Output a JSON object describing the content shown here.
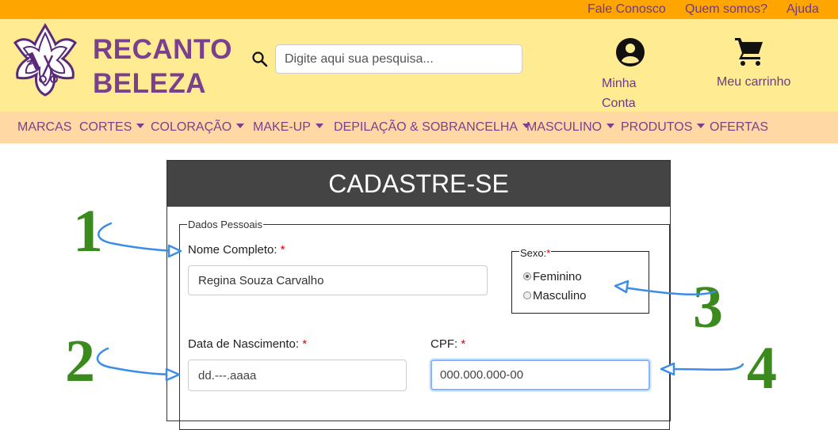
{
  "top_links": [
    "Fale Conosco",
    "Quem somos?",
    "Ajuda"
  ],
  "brand": {
    "line1": "RECANTO",
    "line2": "BELEZA"
  },
  "search": {
    "placeholder": "Digite aqui sua pesquisa..."
  },
  "account": {
    "label": "Minha Conta"
  },
  "cart": {
    "label": "Meu carrinho"
  },
  "nav": [
    {
      "label": "MARCAS"
    },
    {
      "label": "CORTES"
    },
    {
      "label": "COLORAÇÃO"
    },
    {
      "label": "MAKE-UP"
    },
    {
      "label": "DEPILAÇÃO & SOBRANCELHA"
    },
    {
      "label": "MASCULINO"
    },
    {
      "label": "PRODUTOS"
    },
    {
      "label": "OFERTAS"
    }
  ],
  "form": {
    "title": "CADASTRE-SE",
    "legend": "Dados Pessoais",
    "name_label": "Nome Completo:",
    "name_value": "Regina Souza Carvalho",
    "birth_label": "Data de Nascimento:",
    "birth_placeholder": "dd.---.aaaa",
    "cpf_label": "CPF:",
    "cpf_placeholder": "000.000.000-00",
    "required_mark": "*",
    "sexo": {
      "legend": "Sexo:",
      "options": [
        {
          "label": "Feminino",
          "checked": true
        },
        {
          "label": "Masculino",
          "checked": false
        }
      ]
    }
  },
  "annotations": [
    "1",
    "2",
    "3",
    "4"
  ],
  "colors": {
    "topbar": "#ffa500",
    "header": "#ffeb91",
    "nav": "#ffd8a3",
    "brand": "#7a3f8e",
    "annotation": "#3a8a1e",
    "arrow": "#3b8de8"
  }
}
